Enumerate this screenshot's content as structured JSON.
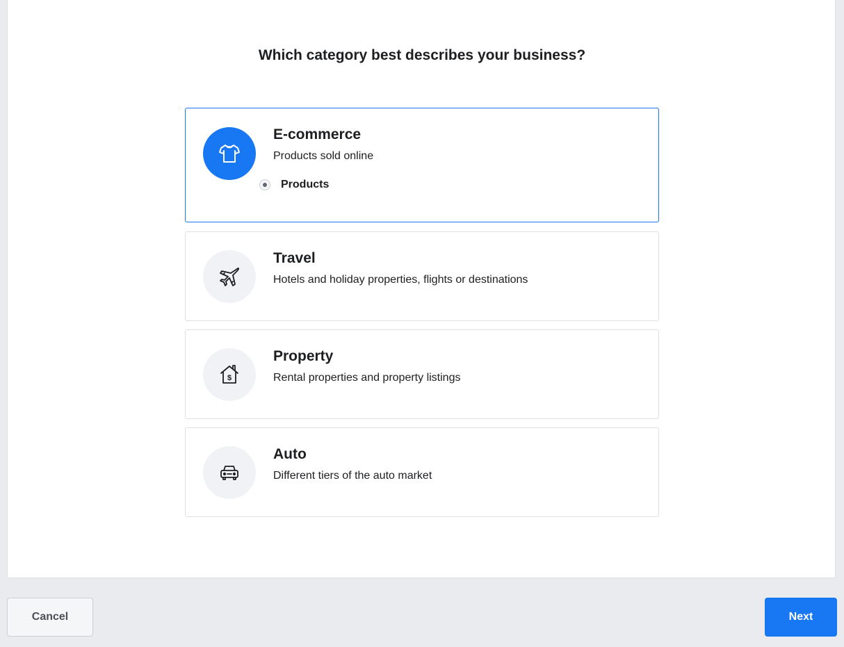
{
  "page": {
    "title": "Which category best describes your business?"
  },
  "categories": [
    {
      "title": "E-commerce",
      "description": "Products sold online",
      "icon": "tshirt-icon",
      "selected": true,
      "sub_option": "Products"
    },
    {
      "title": "Travel",
      "description": "Hotels and holiday properties, flights or destinations",
      "icon": "airplane-icon",
      "selected": false
    },
    {
      "title": "Property",
      "description": "Rental properties and property listings",
      "icon": "house-dollar-icon",
      "selected": false
    },
    {
      "title": "Auto",
      "description": "Different tiers of the auto market",
      "icon": "car-icon",
      "selected": false
    }
  ],
  "footer": {
    "cancel_label": "Cancel",
    "next_label": "Next"
  },
  "colors": {
    "accent": "#1877f2",
    "background": "#e9ebee",
    "panel": "#ffffff",
    "icon_bg": "#f0f2f5"
  }
}
